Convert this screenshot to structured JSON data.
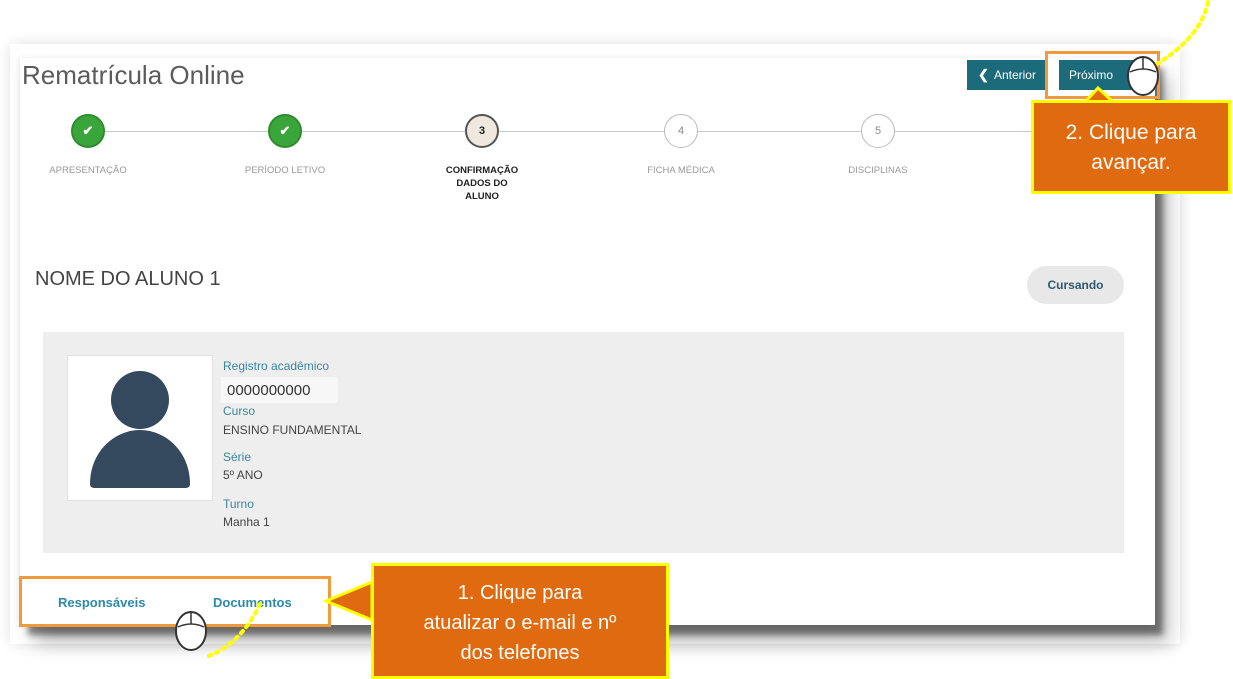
{
  "app": {
    "title": "Rematrícula Online"
  },
  "nav": {
    "prev_label": "Anterior",
    "next_label": "Próximo"
  },
  "stepper": {
    "steps": [
      {
        "label": "APRESENTAÇÃO",
        "number": "",
        "state": "done"
      },
      {
        "label": "PERÍODO LETIVO",
        "number": "",
        "state": "done"
      },
      {
        "label": "CONFIRMAÇÃO DADOS DO ALUNO",
        "number": "3",
        "state": "current"
      },
      {
        "label": "FICHA MÉDICA",
        "number": "4",
        "state": "pending"
      },
      {
        "label": "DISCIPLINAS",
        "number": "5",
        "state": "pending"
      }
    ]
  },
  "student": {
    "name": "NOME DO ALUNO 1",
    "status": "Cursando",
    "fields": {
      "ra_label": "Registro acadêmico",
      "ra_value": "0000000000",
      "course_label": "Curso",
      "course_value": "ENSINO FUNDAMENTAL",
      "grade_label": "Série",
      "grade_value": "5º ANO",
      "shift_label": "Turno",
      "shift_value": "Manha 1"
    }
  },
  "tabs": {
    "guardians": "Responsáveis",
    "documents": "Documentos"
  },
  "annotations": {
    "callout1": [
      "1. Clique para",
      "atualizar o e-mail e nº",
      "dos telefones"
    ],
    "callout2": [
      "2. Clique para",
      "avançar."
    ]
  },
  "colors": {
    "primary_button": "#1c6b7a",
    "step_done": "#3aa53a",
    "link": "#2b8aa8",
    "callout_fill": "#e06a10",
    "callout_border": "#ffff00",
    "highlight_border": "#f09a3c"
  }
}
